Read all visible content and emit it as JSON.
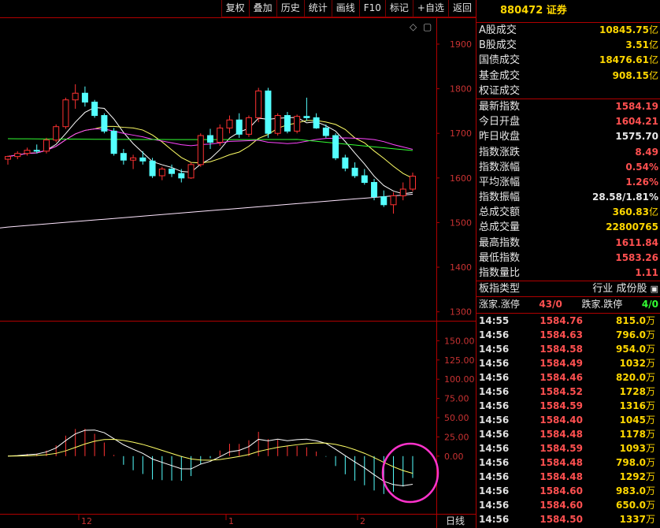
{
  "toolbar": [
    "复权",
    "叠加",
    "历史",
    "统计",
    "画线",
    "F10",
    "标记",
    "+自选",
    "返回"
  ],
  "chart_icons": {
    "diamond": "◇",
    "box": "▢"
  },
  "price_axis": [
    "1900",
    "1800",
    "1700",
    "1600",
    "1500",
    "1400",
    "1300"
  ],
  "macd_axis": [
    "150.00",
    "125.00",
    "100.00",
    "75.00",
    "50.00",
    "25.00",
    "0.00"
  ],
  "x_axis": {
    "labels": [
      "12",
      "1",
      "2"
    ],
    "period": "日线"
  },
  "chart_data": {
    "type": "candlestick",
    "price_ylim": [
      1280,
      1960
    ],
    "macd_ylim": [
      -75,
      175
    ],
    "candles": [
      {
        "o": 1642,
        "h": 1650,
        "l": 1630,
        "c": 1648
      },
      {
        "o": 1648,
        "h": 1660,
        "l": 1642,
        "c": 1655
      },
      {
        "o": 1655,
        "h": 1668,
        "l": 1650,
        "c": 1662
      },
      {
        "o": 1662,
        "h": 1675,
        "l": 1655,
        "c": 1660
      },
      {
        "o": 1660,
        "h": 1690,
        "l": 1655,
        "c": 1685
      },
      {
        "o": 1685,
        "h": 1720,
        "l": 1680,
        "c": 1715
      },
      {
        "o": 1715,
        "h": 1780,
        "l": 1710,
        "c": 1775
      },
      {
        "o": 1775,
        "h": 1810,
        "l": 1755,
        "c": 1790
      },
      {
        "o": 1790,
        "h": 1805,
        "l": 1760,
        "c": 1770
      },
      {
        "o": 1770,
        "h": 1775,
        "l": 1735,
        "c": 1740
      },
      {
        "o": 1740,
        "h": 1745,
        "l": 1700,
        "c": 1705
      },
      {
        "o": 1705,
        "h": 1712,
        "l": 1650,
        "c": 1655
      },
      {
        "o": 1655,
        "h": 1665,
        "l": 1630,
        "c": 1640
      },
      {
        "o": 1640,
        "h": 1652,
        "l": 1620,
        "c": 1645
      },
      {
        "o": 1645,
        "h": 1660,
        "l": 1630,
        "c": 1638
      },
      {
        "o": 1638,
        "h": 1645,
        "l": 1600,
        "c": 1605
      },
      {
        "o": 1605,
        "h": 1625,
        "l": 1595,
        "c": 1620
      },
      {
        "o": 1620,
        "h": 1630,
        "l": 1602,
        "c": 1610
      },
      {
        "o": 1610,
        "h": 1620,
        "l": 1590,
        "c": 1600
      },
      {
        "o": 1600,
        "h": 1635,
        "l": 1598,
        "c": 1630
      },
      {
        "o": 1630,
        "h": 1700,
        "l": 1625,
        "c": 1695
      },
      {
        "o": 1695,
        "h": 1710,
        "l": 1665,
        "c": 1680
      },
      {
        "o": 1680,
        "h": 1720,
        "l": 1672,
        "c": 1712
      },
      {
        "o": 1712,
        "h": 1740,
        "l": 1700,
        "c": 1730
      },
      {
        "o": 1730,
        "h": 1745,
        "l": 1690,
        "c": 1698
      },
      {
        "o": 1698,
        "h": 1740,
        "l": 1692,
        "c": 1735
      },
      {
        "o": 1735,
        "h": 1802,
        "l": 1725,
        "c": 1795
      },
      {
        "o": 1795,
        "h": 1802,
        "l": 1690,
        "c": 1700
      },
      {
        "o": 1700,
        "h": 1745,
        "l": 1695,
        "c": 1740
      },
      {
        "o": 1740,
        "h": 1748,
        "l": 1700,
        "c": 1705
      },
      {
        "o": 1705,
        "h": 1742,
        "l": 1700,
        "c": 1738
      },
      {
        "o": 1738,
        "h": 1780,
        "l": 1728,
        "c": 1735
      },
      {
        "o": 1735,
        "h": 1745,
        "l": 1710,
        "c": 1712
      },
      {
        "o": 1712,
        "h": 1720,
        "l": 1690,
        "c": 1695
      },
      {
        "o": 1695,
        "h": 1700,
        "l": 1640,
        "c": 1645
      },
      {
        "o": 1645,
        "h": 1652,
        "l": 1615,
        "c": 1622
      },
      {
        "o": 1622,
        "h": 1635,
        "l": 1600,
        "c": 1605
      },
      {
        "o": 1605,
        "h": 1620,
        "l": 1585,
        "c": 1590
      },
      {
        "o": 1590,
        "h": 1598,
        "l": 1550,
        "c": 1558
      },
      {
        "o": 1558,
        "h": 1572,
        "l": 1535,
        "c": 1540
      },
      {
        "o": 1540,
        "h": 1568,
        "l": 1520,
        "c": 1560
      },
      {
        "o": 1560,
        "h": 1590,
        "l": 1550,
        "c": 1575
      },
      {
        "o": 1575,
        "h": 1612,
        "l": 1570,
        "c": 1604
      }
    ],
    "ma_lines": [
      {
        "name": "MA5",
        "color": "#ffffff"
      },
      {
        "name": "MA10",
        "color": "#ffff66"
      },
      {
        "name": "MA20",
        "color": "#ff44ff"
      },
      {
        "name": "MA60",
        "color": "#33ff33"
      },
      {
        "name": "MA250",
        "color": "#ffe6ff"
      }
    ],
    "highlight_color": "#ff33cc"
  },
  "right_panel": {
    "title": "880472 证券",
    "stats": [
      {
        "label": "A股成交",
        "value": "10845.75",
        "unit": "亿",
        "color": "#ffd700"
      },
      {
        "label": "B股成交",
        "value": "3.51",
        "unit": "亿",
        "color": "#ffd700"
      },
      {
        "label": "国债成交",
        "value": "18476.61",
        "unit": "亿",
        "color": "#ffd700"
      },
      {
        "label": "基金成交",
        "value": "908.15",
        "unit": "亿",
        "color": "#ffd700"
      },
      {
        "label": "权证成交",
        "value": "",
        "unit": "",
        "color": "#ffd700"
      }
    ],
    "index_stats": [
      {
        "label": "最新指数",
        "value": "1584.19",
        "unit": "",
        "color": "#ff5050"
      },
      {
        "label": "今日开盘",
        "value": "1604.21",
        "unit": "",
        "color": "#ff5050"
      },
      {
        "label": "昨日收盘",
        "value": "1575.70",
        "unit": "",
        "color": "#e8e8e8"
      },
      {
        "label": "指数涨跌",
        "value": "8.49",
        "unit": "",
        "color": "#ff5050"
      },
      {
        "label": "指数涨幅",
        "value": "0.54%",
        "unit": "",
        "color": "#ff5050"
      },
      {
        "label": "平均涨幅",
        "value": "1.26%",
        "unit": "",
        "color": "#ff5050"
      },
      {
        "label": "指数振幅",
        "value": "28.58/1.81%",
        "unit": "",
        "color": "#e8e8e8"
      },
      {
        "label": "总成交额",
        "value": "360.83",
        "unit": "亿",
        "color": "#ffd700"
      },
      {
        "label": "总成交量",
        "value": "22800765",
        "unit": "",
        "color": "#ffd700"
      },
      {
        "label": "最高指数",
        "value": "1611.84",
        "unit": "",
        "color": "#ff5050"
      },
      {
        "label": "最低指数",
        "value": "1583.26",
        "unit": "",
        "color": "#ff5050"
      },
      {
        "label": "指数量比",
        "value": "1.11",
        "unit": "",
        "color": "#ff5050"
      }
    ],
    "board": {
      "label": "板指类型",
      "industry": "行业",
      "components": "成份股"
    },
    "breadth": {
      "up_label": "涨家.涨停",
      "up_value": "43/0",
      "down_label": "跌家.跌停",
      "down_value": "4/0"
    },
    "ticks": [
      {
        "t": "14:55",
        "p": "1584.76",
        "v": "815.0",
        "u": "万"
      },
      {
        "t": "14:56",
        "p": "1584.63",
        "v": "796.0",
        "u": "万"
      },
      {
        "t": "14:56",
        "p": "1584.58",
        "v": "954.0",
        "u": "万"
      },
      {
        "t": "14:56",
        "p": "1584.49",
        "v": "1032",
        "u": "万"
      },
      {
        "t": "14:56",
        "p": "1584.46",
        "v": "820.0",
        "u": "万"
      },
      {
        "t": "14:56",
        "p": "1584.52",
        "v": "1728",
        "u": "万"
      },
      {
        "t": "14:56",
        "p": "1584.59",
        "v": "1316",
        "u": "万"
      },
      {
        "t": "14:56",
        "p": "1584.40",
        "v": "1045",
        "u": "万"
      },
      {
        "t": "14:56",
        "p": "1584.48",
        "v": "1178",
        "u": "万"
      },
      {
        "t": "14:56",
        "p": "1584.59",
        "v": "1093",
        "u": "万"
      },
      {
        "t": "14:56",
        "p": "1584.48",
        "v": "798.0",
        "u": "万"
      },
      {
        "t": "14:56",
        "p": "1584.48",
        "v": "1292",
        "u": "万"
      },
      {
        "t": "14:56",
        "p": "1584.60",
        "v": "983.0",
        "u": "万"
      },
      {
        "t": "14:56",
        "p": "1584.60",
        "v": "650.0",
        "u": "万"
      },
      {
        "t": "14:56",
        "p": "1584.50",
        "v": "1337",
        "u": "万"
      }
    ]
  }
}
